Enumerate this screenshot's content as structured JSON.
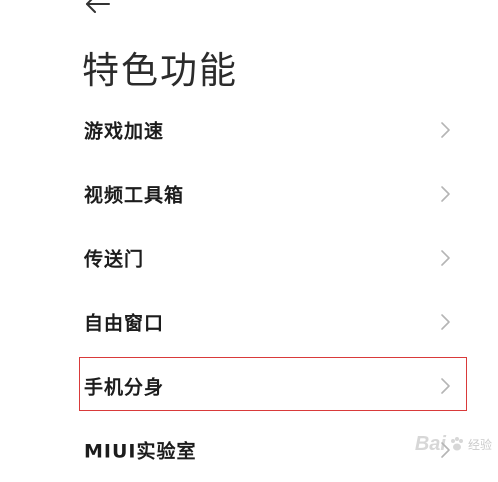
{
  "header": {
    "back_icon": "arrow-left-icon",
    "title": "特色功能"
  },
  "settings": {
    "items": [
      {
        "label": "游戏加速",
        "icon": "chevron-right-icon",
        "highlighted": false
      },
      {
        "label": "视频工具箱",
        "icon": "chevron-right-icon",
        "highlighted": false
      },
      {
        "label": "传送门",
        "icon": "chevron-right-icon",
        "highlighted": false
      },
      {
        "label": "自由窗口",
        "icon": "chevron-right-icon",
        "highlighted": false
      },
      {
        "label": "手机分身",
        "icon": "chevron-right-icon",
        "highlighted": true
      },
      {
        "label": "MIUI实验室",
        "icon": "chevron-right-icon",
        "highlighted": false
      }
    ]
  },
  "watermark": {
    "brand": "Bai",
    "text": "经验"
  },
  "colors": {
    "background": "#ffffff",
    "text": "#1c1c1c",
    "chevron": "#b5b5b5",
    "highlight_border": "#d93a3a"
  }
}
